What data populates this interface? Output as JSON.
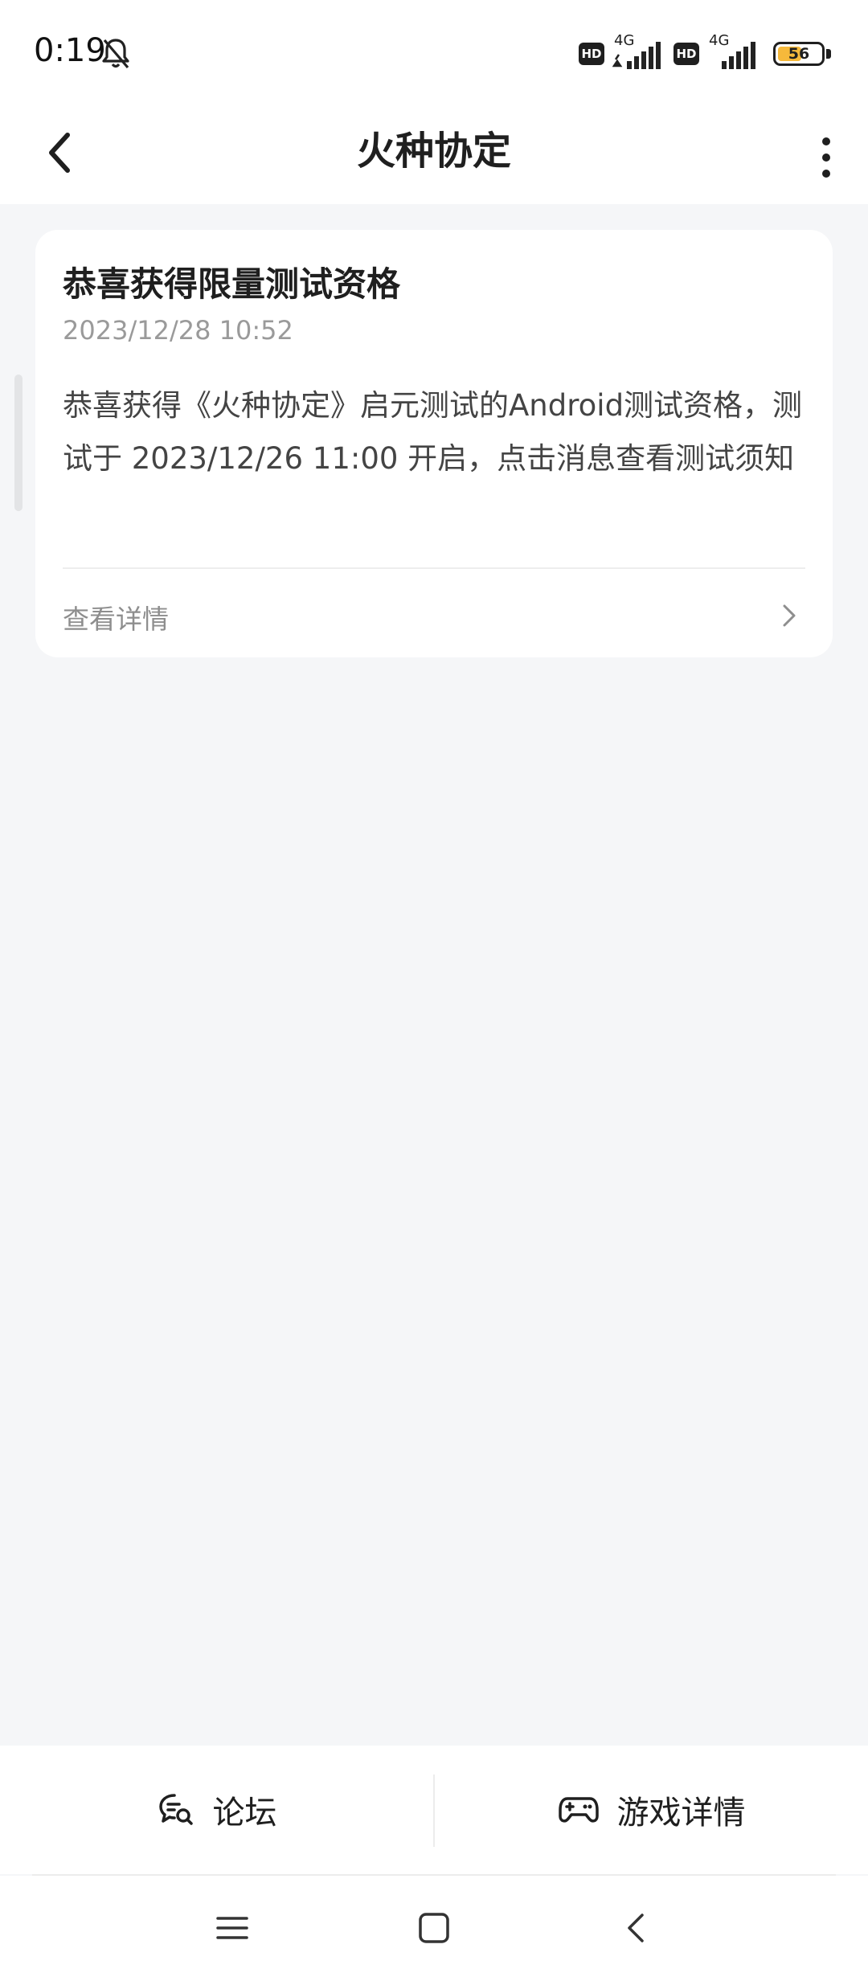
{
  "status_bar": {
    "time": "0:19",
    "hd_label": "HD",
    "network_1": "4G",
    "network_2": "4G",
    "battery_level": "56",
    "battery_color": "#f6b93b"
  },
  "header": {
    "title": "火种协定",
    "back_icon": "chevron-left-icon",
    "more_icon": "more-vertical-icon"
  },
  "message": {
    "title": "恭喜获得限量测试资格",
    "timestamp": "2023/12/28 10:52",
    "body": "恭喜获得《火种协定》启元测试的Android测试资格，测试于 2023/12/26 11:00 开启，点击消息查看测试须知",
    "link_label": "查看详情"
  },
  "bottom_bar": {
    "forum_label": "论坛",
    "forum_icon": "chat-search-icon",
    "game_details_label": "游戏详情",
    "game_details_icon": "gamepad-icon"
  },
  "system_nav": {
    "menu_icon": "menu-icon",
    "home_icon": "home-square-icon",
    "back_icon": "back-triangle-icon"
  }
}
